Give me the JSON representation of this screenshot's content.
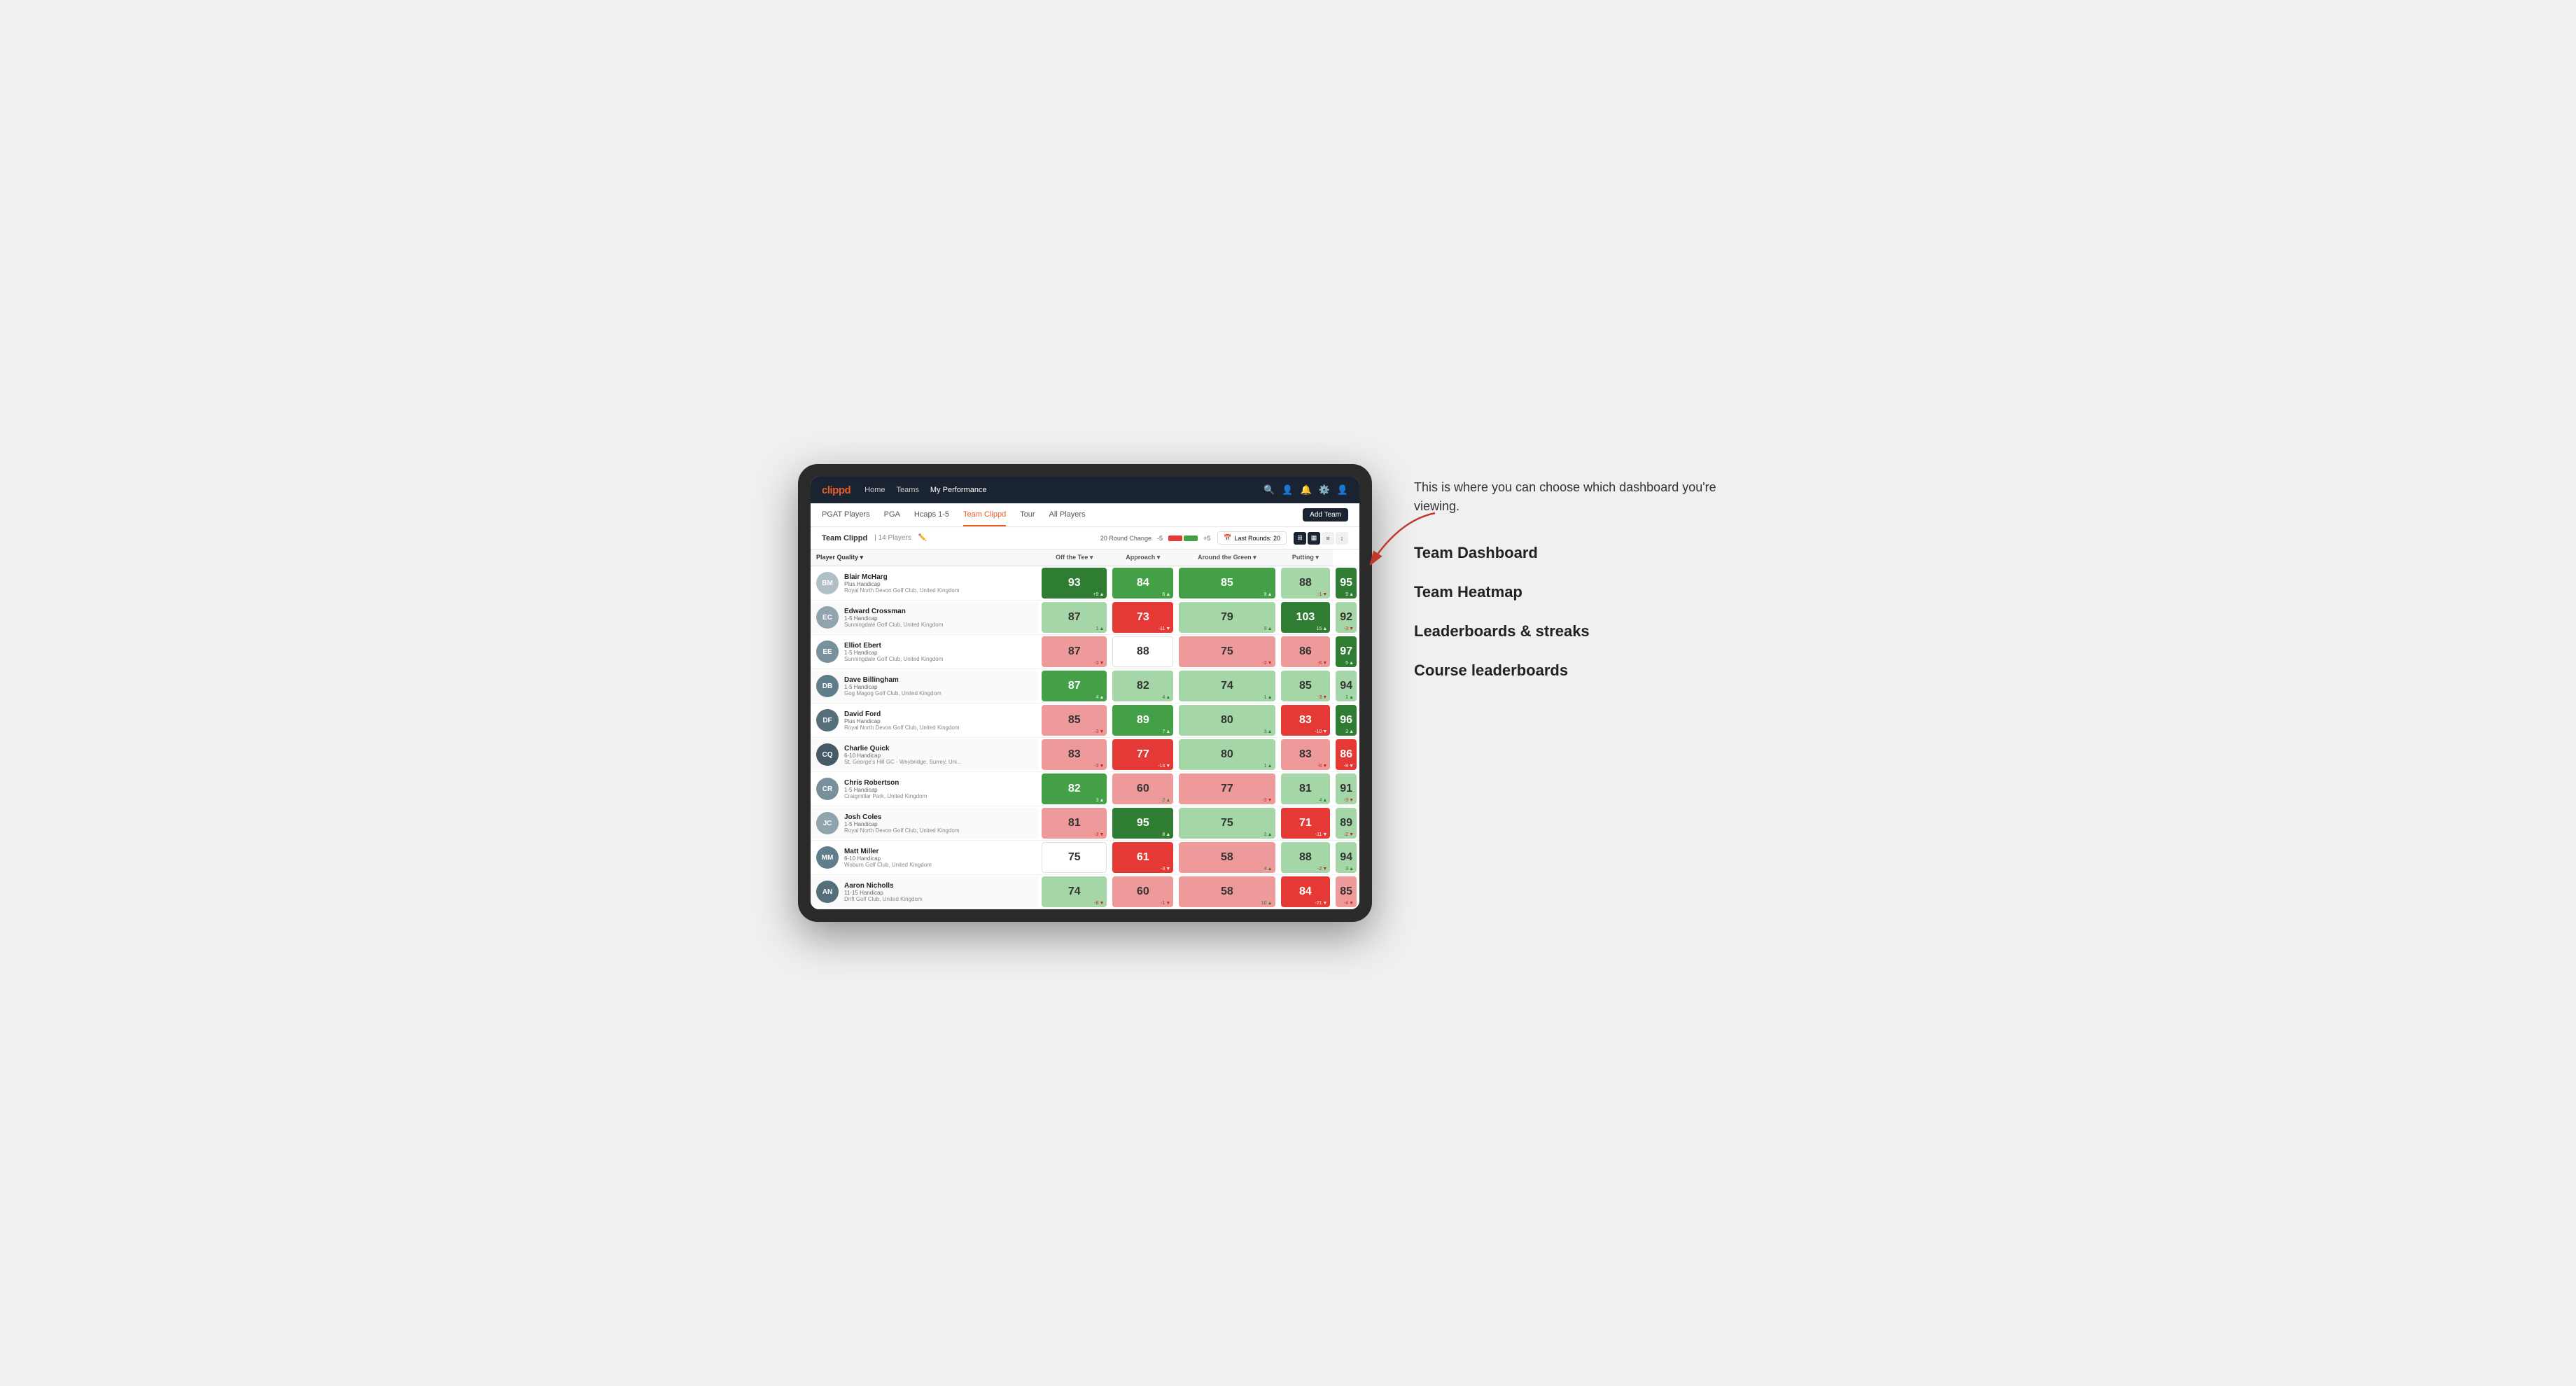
{
  "annotation": {
    "callout": "This is where you can choose which dashboard you're viewing.",
    "items": [
      "Team Dashboard",
      "Team Heatmap",
      "Leaderboards & streaks",
      "Course leaderboards"
    ]
  },
  "nav": {
    "logo": "clippd",
    "items": [
      "Home",
      "Teams",
      "My Performance"
    ],
    "active": "My Performance"
  },
  "sub_nav": {
    "items": [
      "PGAT Players",
      "PGA",
      "Hcaps 1-5",
      "Team Clippd",
      "Tour",
      "All Players"
    ],
    "active": "Team Clippd",
    "add_team": "Add Team"
  },
  "team_header": {
    "title": "Team Clippd",
    "separator": "|",
    "count": "14 Players",
    "round_change_label": "20 Round Change",
    "range_negative": "-5",
    "range_positive": "+5",
    "last_rounds_label": "Last Rounds:",
    "last_rounds_value": "20"
  },
  "table": {
    "headers": {
      "player": "Player Quality",
      "off_tee": "Off the Tee",
      "approach": "Approach",
      "around_green": "Around the Green",
      "putting": "Putting"
    },
    "players": [
      {
        "name": "Blair McHarg",
        "handicap": "Plus Handicap",
        "club": "Royal North Devon Golf Club, United Kingdom",
        "quality": 93,
        "quality_change": "+9",
        "quality_dir": "up",
        "quality_color": "green-dark",
        "off_tee": 84,
        "off_tee_change": "6",
        "off_tee_dir": "up",
        "off_tee_color": "green",
        "approach": 85,
        "approach_change": "8",
        "approach_dir": "up",
        "approach_color": "green",
        "around_green": 88,
        "around_change": "-1",
        "around_dir": "down",
        "around_color": "green-light",
        "putting": 95,
        "putting_change": "9",
        "putting_dir": "up",
        "putting_color": "green-dark"
      },
      {
        "name": "Edward Crossman",
        "handicap": "1-5 Handicap",
        "club": "Sunningdale Golf Club, United Kingdom",
        "quality": 87,
        "quality_change": "1",
        "quality_dir": "up",
        "quality_color": "green-light",
        "off_tee": 73,
        "off_tee_change": "-11",
        "off_tee_dir": "down",
        "off_tee_color": "red",
        "approach": 79,
        "approach_change": "9",
        "approach_dir": "up",
        "approach_color": "green-light",
        "around_green": 103,
        "around_change": "15",
        "around_dir": "up",
        "around_color": "green-dark",
        "putting": 92,
        "putting_change": "-3",
        "putting_dir": "down",
        "putting_color": "green-light"
      },
      {
        "name": "Elliot Ebert",
        "handicap": "1-5 Handicap",
        "club": "Sunningdale Golf Club, United Kingdom",
        "quality": 87,
        "quality_change": "-3",
        "quality_dir": "down",
        "quality_color": "red-light",
        "off_tee": 88,
        "off_tee_change": "",
        "off_tee_dir": "",
        "off_tee_color": "white",
        "approach": 75,
        "approach_change": "-3",
        "approach_dir": "down",
        "approach_color": "red-light",
        "around_green": 86,
        "around_change": "-6",
        "around_dir": "down",
        "around_color": "red-light",
        "putting": 97,
        "putting_change": "5",
        "putting_dir": "up",
        "putting_color": "green-dark"
      },
      {
        "name": "Dave Billingham",
        "handicap": "1-5 Handicap",
        "club": "Gog Magog Golf Club, United Kingdom",
        "quality": 87,
        "quality_change": "4",
        "quality_dir": "up",
        "quality_color": "green",
        "off_tee": 82,
        "off_tee_change": "4",
        "off_tee_dir": "up",
        "off_tee_color": "green-light",
        "approach": 74,
        "approach_change": "1",
        "approach_dir": "up",
        "approach_color": "green-light",
        "around_green": 85,
        "around_change": "-3",
        "around_dir": "down",
        "around_color": "green-light",
        "putting": 94,
        "putting_change": "1",
        "putting_dir": "up",
        "putting_color": "green-light"
      },
      {
        "name": "David Ford",
        "handicap": "Plus Handicap",
        "club": "Royal North Devon Golf Club, United Kingdom",
        "quality": 85,
        "quality_change": "-3",
        "quality_dir": "down",
        "quality_color": "red-light",
        "off_tee": 89,
        "off_tee_change": "7",
        "off_tee_dir": "up",
        "off_tee_color": "green",
        "approach": 80,
        "approach_change": "3",
        "approach_dir": "up",
        "approach_color": "green-light",
        "around_green": 83,
        "around_change": "-10",
        "around_dir": "down",
        "around_color": "red",
        "putting": 96,
        "putting_change": "3",
        "putting_dir": "up",
        "putting_color": "green-dark"
      },
      {
        "name": "Charlie Quick",
        "handicap": "6-10 Handicap",
        "club": "St. George's Hill GC - Weybridge, Surrey, Uni...",
        "quality": 83,
        "quality_change": "-3",
        "quality_dir": "down",
        "quality_color": "red-light",
        "off_tee": 77,
        "off_tee_change": "-14",
        "off_tee_dir": "down",
        "off_tee_color": "red",
        "approach": 80,
        "approach_change": "1",
        "approach_dir": "up",
        "approach_color": "green-light",
        "around_green": 83,
        "around_change": "-6",
        "around_dir": "down",
        "around_color": "red-light",
        "putting": 86,
        "putting_change": "-8",
        "putting_dir": "down",
        "putting_color": "red"
      },
      {
        "name": "Chris Robertson",
        "handicap": "1-5 Handicap",
        "club": "Craigmillar Park, United Kingdom",
        "quality": 82,
        "quality_change": "3",
        "quality_dir": "up",
        "quality_color": "green",
        "off_tee": 60,
        "off_tee_change": "2",
        "off_tee_dir": "up",
        "off_tee_color": "red-light",
        "approach": 77,
        "approach_change": "-3",
        "approach_dir": "down",
        "approach_color": "red-light",
        "around_green": 81,
        "around_change": "4",
        "around_dir": "up",
        "around_color": "green-light",
        "putting": 91,
        "putting_change": "-3",
        "putting_dir": "down",
        "putting_color": "green-light"
      },
      {
        "name": "Josh Coles",
        "handicap": "1-5 Handicap",
        "club": "Royal North Devon Golf Club, United Kingdom",
        "quality": 81,
        "quality_change": "-3",
        "quality_dir": "down",
        "quality_color": "red-light",
        "off_tee": 95,
        "off_tee_change": "8",
        "off_tee_dir": "up",
        "off_tee_color": "green-dark",
        "approach": 75,
        "approach_change": "2",
        "approach_dir": "up",
        "approach_color": "green-light",
        "around_green": 71,
        "around_change": "-11",
        "around_dir": "down",
        "around_color": "red",
        "putting": 89,
        "putting_change": "-2",
        "putting_dir": "down",
        "putting_color": "green-light"
      },
      {
        "name": "Matt Miller",
        "handicap": "6-10 Handicap",
        "club": "Woburn Golf Club, United Kingdom",
        "quality": 75,
        "quality_change": "",
        "quality_dir": "",
        "quality_color": "white",
        "off_tee": 61,
        "off_tee_change": "-3",
        "off_tee_dir": "down",
        "off_tee_color": "red",
        "approach": 58,
        "approach_change": "4",
        "approach_dir": "up",
        "approach_color": "red-light",
        "around_green": 88,
        "around_change": "-2",
        "around_dir": "down",
        "around_color": "green-light",
        "putting": 94,
        "putting_change": "3",
        "putting_dir": "up",
        "putting_color": "green-light"
      },
      {
        "name": "Aaron Nicholls",
        "handicap": "11-15 Handicap",
        "club": "Drift Golf Club, United Kingdom",
        "quality": 74,
        "quality_change": "-8",
        "quality_dir": "down",
        "quality_color": "green-light",
        "off_tee": 60,
        "off_tee_change": "-1",
        "off_tee_dir": "down",
        "off_tee_color": "red-light",
        "approach": 58,
        "approach_change": "10",
        "approach_dir": "up",
        "approach_color": "red-light",
        "around_green": 84,
        "around_change": "-21",
        "around_dir": "down",
        "around_color": "red",
        "putting": 85,
        "putting_change": "-4",
        "putting_dir": "down",
        "putting_color": "red-light"
      }
    ]
  }
}
